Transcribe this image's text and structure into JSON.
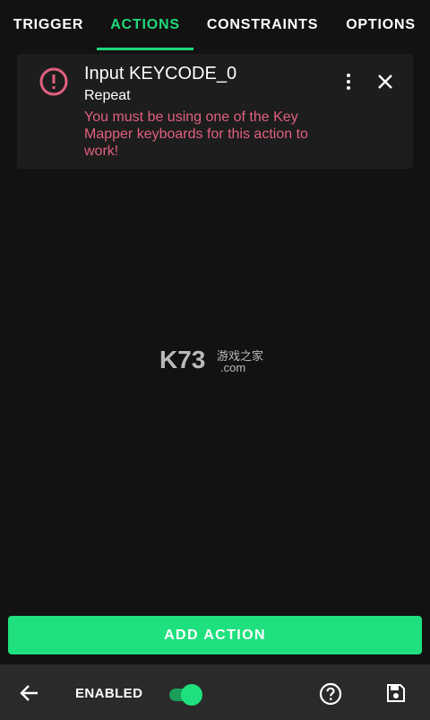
{
  "tabs": [
    {
      "label": "TRIGGER",
      "active": false
    },
    {
      "label": "ACTIONS",
      "active": true
    },
    {
      "label": "CONSTRAINTS",
      "active": false
    },
    {
      "label": "OPTIONS",
      "active": false
    }
  ],
  "action_card": {
    "icon": "alert-circle-icon",
    "title": "Input KEYCODE_0",
    "subtitle": "Repeat",
    "error": "You must be using one of the Key Mapper keyboards for this action to work!",
    "more_icon": "more-vert-icon",
    "close_icon": "close-icon"
  },
  "watermark": {
    "main": "K73",
    "cn": "游戏之家",
    "domain": ".com"
  },
  "add_action_label": "ADD ACTION",
  "bottom_bar": {
    "back_icon": "arrow-back-icon",
    "enabled_label": "ENABLED",
    "enabled": true,
    "help_icon": "help-circle-icon",
    "save_icon": "save-icon"
  },
  "colors": {
    "accent": "#1fd97a",
    "button": "#1fe07e",
    "error": "#e0607e",
    "background": "#121212",
    "card": "#1d1d1d",
    "bottom_bar": "#2a2a2a"
  }
}
